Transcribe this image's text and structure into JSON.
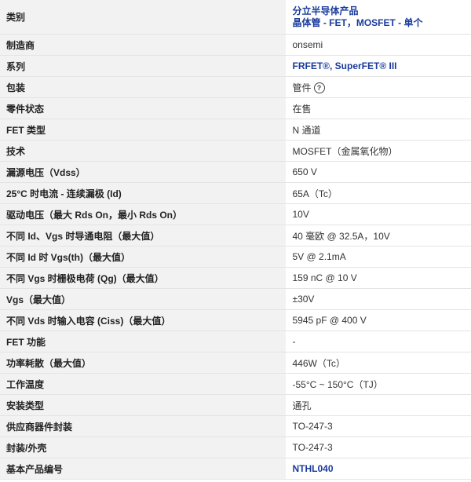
{
  "rows": [
    {
      "label": "类别",
      "value_lines": [
        "分立半导体产品",
        "晶体管 - FET，MOSFET - 单个"
      ],
      "link": true
    },
    {
      "label": "制造商",
      "value": "onsemi"
    },
    {
      "label": "系列",
      "value": "FRFET®, SuperFET® III",
      "link": true
    },
    {
      "label": "包装",
      "value": "管件",
      "help_icon": "help-circle-icon"
    },
    {
      "label": "零件状态",
      "value": "在售"
    },
    {
      "label": "FET 类型",
      "value": "N 通道"
    },
    {
      "label": "技术",
      "value": "MOSFET（金属氧化物）"
    },
    {
      "label": "漏源电压（Vdss）",
      "value": "650 V"
    },
    {
      "label": "25°C 时电流 - 连续漏极 (Id)",
      "value": "65A（Tc）"
    },
    {
      "label": "驱动电压（最大 Rds On，最小 Rds On）",
      "value": "10V"
    },
    {
      "label": "不同 Id、Vgs 时导通电阻（最大值）",
      "value": "40 毫欧 @ 32.5A，10V"
    },
    {
      "label": "不同 Id 时 Vgs(th)（最大值）",
      "value": "5V @ 2.1mA"
    },
    {
      "label": "不同 Vgs 时栅极电荷 (Qg)（最大值）",
      "value": "159 nC @ 10 V"
    },
    {
      "label": "Vgs（最大值）",
      "value": "±30V"
    },
    {
      "label": "不同 Vds 时输入电容 (Ciss)（最大值）",
      "value": "5945 pF @ 400 V"
    },
    {
      "label": "FET 功能",
      "value": "-"
    },
    {
      "label": "功率耗散（最大值）",
      "value": "446W（Tc）"
    },
    {
      "label": "工作温度",
      "value": "-55°C ~ 150°C（TJ）"
    },
    {
      "label": "安装类型",
      "value": "通孔"
    },
    {
      "label": "供应商器件封装",
      "value": "TO-247-3"
    },
    {
      "label": "封装/外壳",
      "value": "TO-247-3"
    },
    {
      "label": "基本产品编号",
      "value": "NTHL040",
      "link": true
    }
  ],
  "help_glyph": "?"
}
